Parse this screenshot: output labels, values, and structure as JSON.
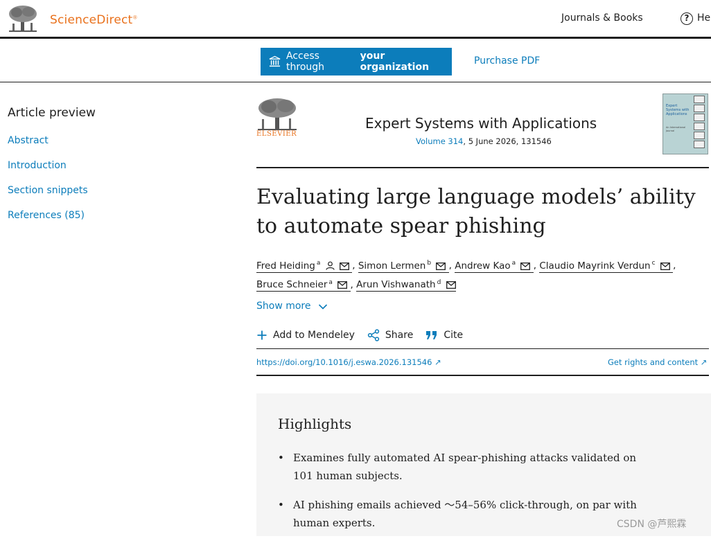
{
  "header": {
    "brand": "ScienceDirect",
    "brand_mark": "®",
    "nav_journals": "Journals & Books",
    "nav_help_partial": "He"
  },
  "access": {
    "access_prefix": "Access through",
    "access_strong": "your organization",
    "purchase": "Purchase PDF"
  },
  "sidebar": {
    "title": "Article preview",
    "items": [
      {
        "label": "Abstract"
      },
      {
        "label": "Introduction"
      },
      {
        "label": "Section snippets"
      },
      {
        "label": "References (85)"
      }
    ]
  },
  "journal": {
    "publisher": "ELSEVIER",
    "title": "Expert Systems with Applications",
    "volume_link": "Volume 314",
    "volume_rest": ", 5 June 2026, 131546",
    "cover_title": "Expert Systems with Applications",
    "cover_sub": "An International Journal"
  },
  "article": {
    "title": "Evaluating large language models’ ability to automate spear phishing",
    "authors": [
      {
        "name": "Fred Heiding",
        "sup": "a"
      },
      {
        "name": "Simon Lermen",
        "sup": "b"
      },
      {
        "name": "Andrew Kao",
        "sup": "a"
      },
      {
        "name": "Claudio Mayrink Verdun",
        "sup": "c"
      },
      {
        "name": "Bruce Schneier",
        "sup": "a"
      },
      {
        "name": "Arun Vishwanath",
        "sup": "d"
      }
    ],
    "show_more": "Show more",
    "actions": {
      "mendeley": "Add to Mendeley",
      "share": "Share",
      "cite": "Cite"
    },
    "doi": "https://doi.org/10.1016/j.eswa.2026.131546",
    "rights": "Get rights and content"
  },
  "highlights": {
    "title": "Highlights",
    "items": [
      "Examines fully automated AI spear-phishing attacks validated on 101 human subjects.",
      "AI phishing emails achieved ～54–56% click-through, on par with human experts."
    ]
  },
  "watermark": "CSDN @芦熙霖",
  "colors": {
    "link": "#0c7dbb",
    "brand": "#e9711c",
    "panel": "#f5f5f5"
  }
}
